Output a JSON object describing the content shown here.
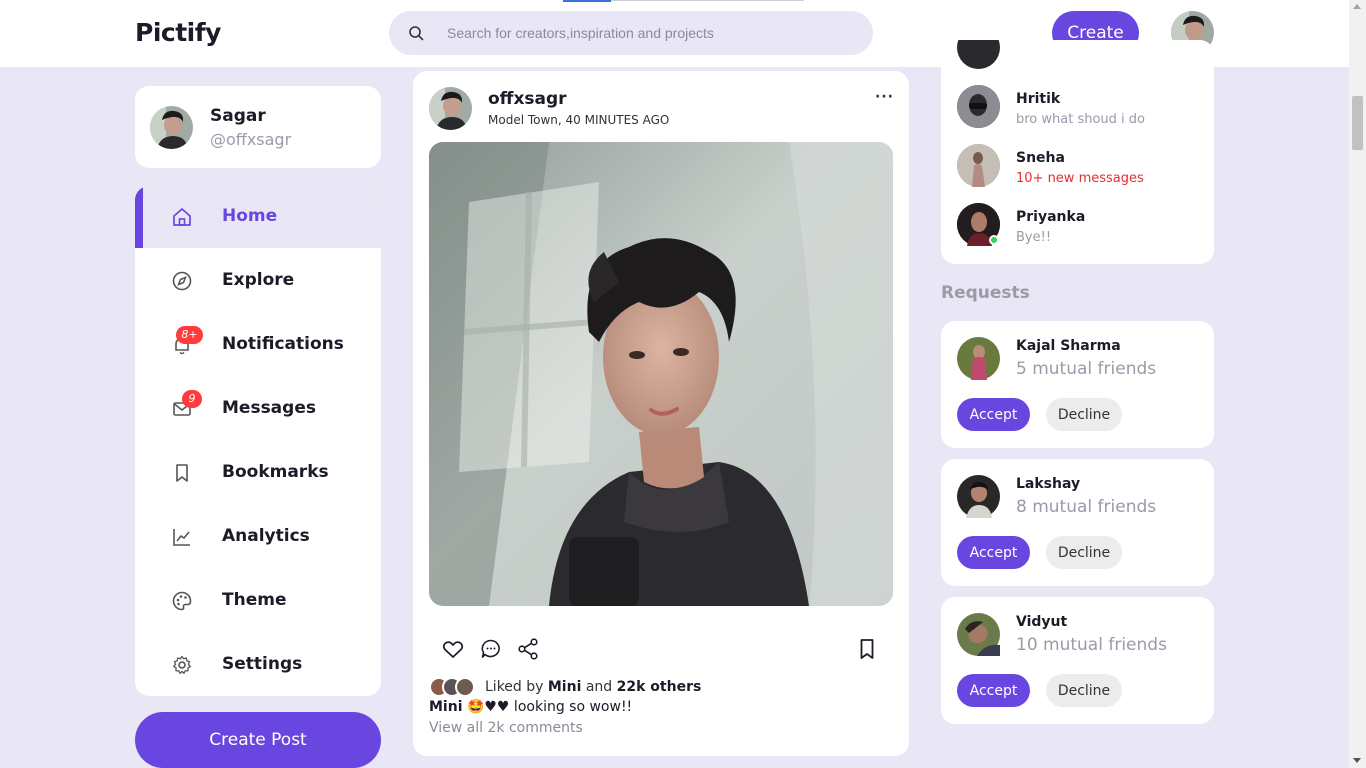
{
  "app": {
    "logo": "Pictify"
  },
  "search": {
    "placeholder": "Search for creators,inspiration and projects"
  },
  "header": {
    "create_label": "Create"
  },
  "profile": {
    "name": "Sagar",
    "handle": "@offxsagr"
  },
  "sidebar": {
    "items": [
      {
        "label": "Home",
        "icon": "home-icon",
        "active": true
      },
      {
        "label": "Explore",
        "icon": "compass-icon"
      },
      {
        "label": "Notifications",
        "icon": "bell-icon",
        "badge": "8+"
      },
      {
        "label": "Messages",
        "icon": "mail-icon",
        "badge": "9"
      },
      {
        "label": "Bookmarks",
        "icon": "bookmark-icon"
      },
      {
        "label": "Analytics",
        "icon": "chart-icon"
      },
      {
        "label": "Theme",
        "icon": "palette-icon"
      },
      {
        "label": "Settings",
        "icon": "gear-icon"
      }
    ],
    "create_post_label": "Create Post"
  },
  "post": {
    "author": "offxsagr",
    "location": "Model Town, 40 MINUTES AGO",
    "more": "···",
    "liked_prefix": "Liked by",
    "liked_user": "Mini",
    "liked_and": "and",
    "liked_others": "22k others",
    "caption_user": "Mini",
    "caption_text": "🤩♥♥ looking so wow!!",
    "view_all": "View all 2k comments"
  },
  "messages": [
    {
      "name": "Hritik",
      "text": "bro what shoud i do",
      "alert": false,
      "online": false
    },
    {
      "name": "Sneha",
      "text": "10+ new messages",
      "alert": true,
      "online": false
    },
    {
      "name": "Priyanka",
      "text": "Bye!!",
      "alert": false,
      "online": true
    }
  ],
  "requests": {
    "title": "Requests",
    "items": [
      {
        "name": "Kajal Sharma",
        "mutual": "5 mutual friends",
        "accept": "Accept",
        "decline": "Decline"
      },
      {
        "name": "Lakshay",
        "mutual": "8 mutual friends",
        "accept": "Accept",
        "decline": "Decline"
      },
      {
        "name": "Vidyut",
        "mutual": "10 mutual friends",
        "accept": "Accept",
        "decline": "Decline"
      }
    ]
  },
  "colors": {
    "accent": "#6a46e0",
    "background": "#e9e6f5",
    "alert": "#ef2a2a",
    "online": "#2fd25a",
    "badge": "#ff3b3b"
  }
}
